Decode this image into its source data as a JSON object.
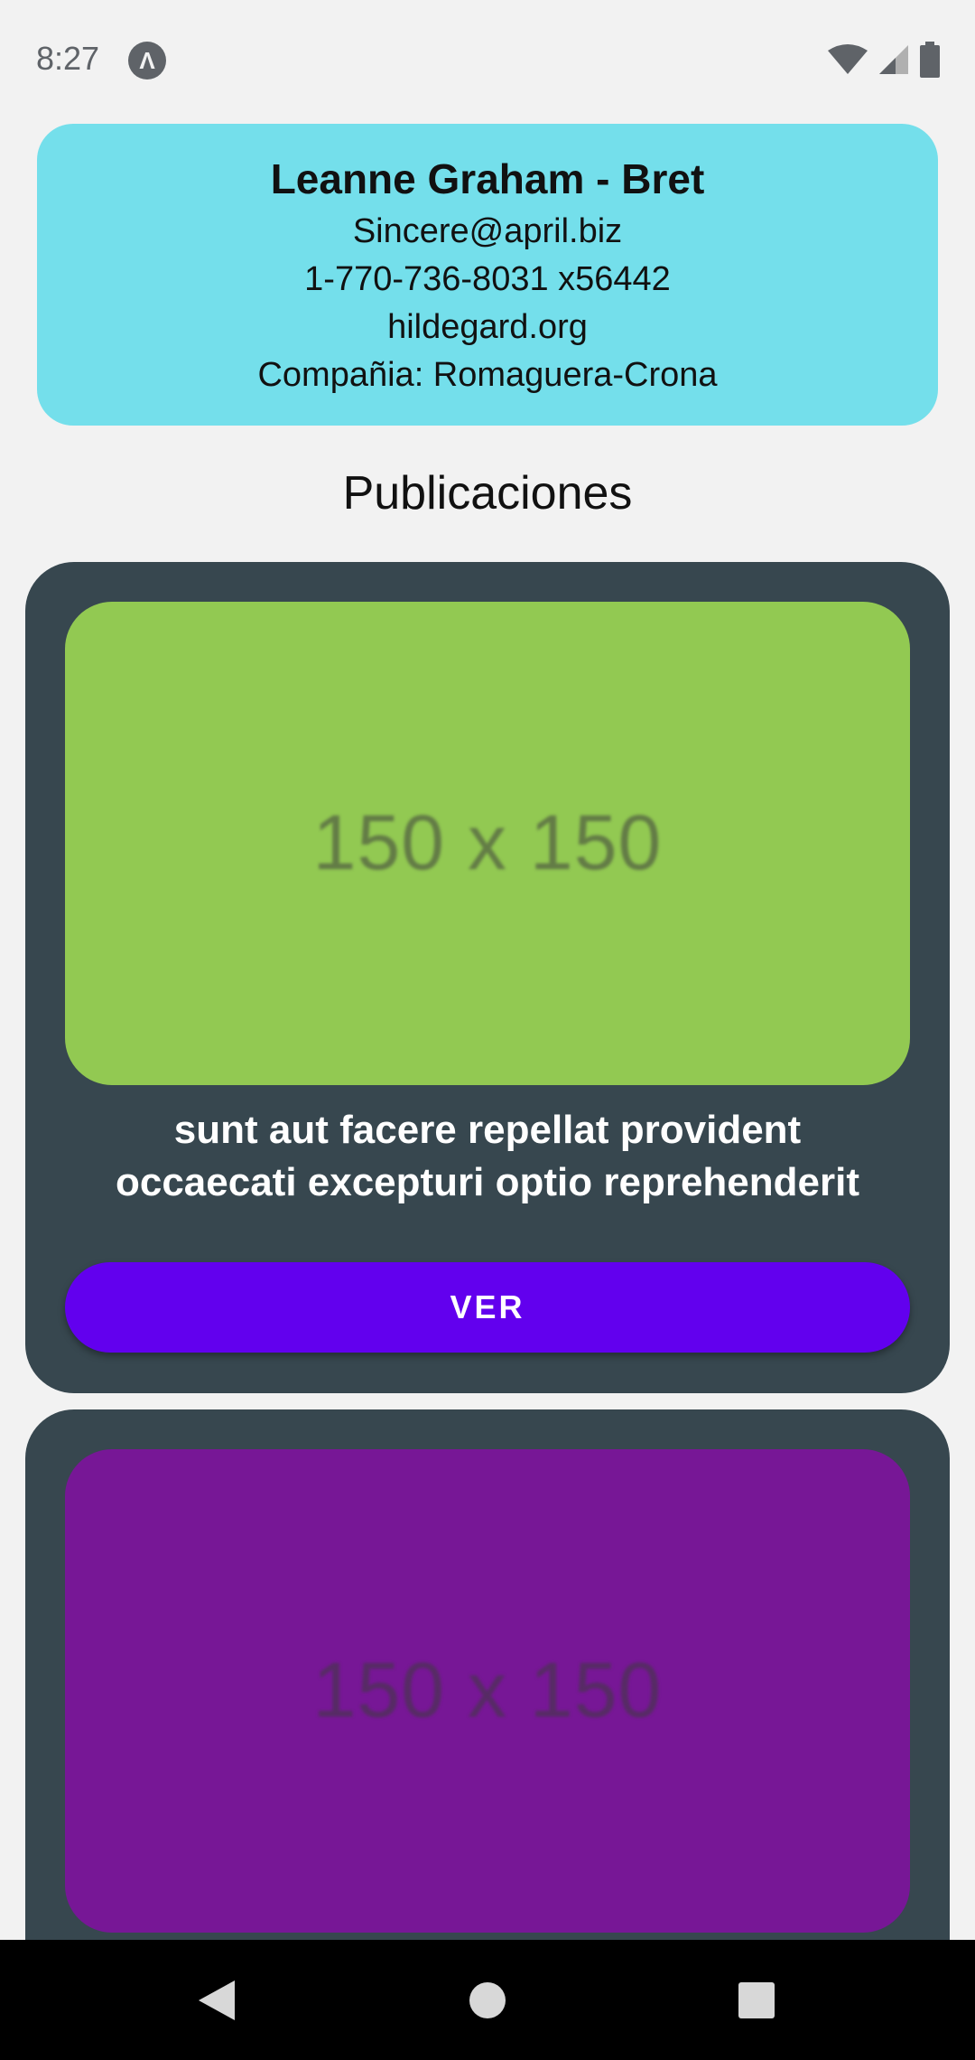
{
  "status_bar": {
    "time": "8:27",
    "app_icon_glyph": "Λ",
    "icons": [
      "wifi-icon",
      "signal-icon",
      "battery-icon"
    ]
  },
  "profile": {
    "name": "Leanne Graham",
    "separator": " - ",
    "username": "Bret",
    "email": "Sincere@april.biz",
    "phone": "1-770-736-8031 x56442",
    "website": "hildegard.org",
    "company_line": "Compañia: Romaguera-Crona",
    "background_color": "#74dfeb"
  },
  "section_title": "Publicaciones",
  "posts": [
    {
      "image_label": "150 x 150",
      "image_color": "#92c952",
      "title": "sunt aut facere repellat provident occaecati excepturi optio reprehenderit",
      "button_label": "VER"
    },
    {
      "image_label": "150 x 150",
      "image_color": "#771796"
    }
  ],
  "colors": {
    "card_background": "#37474f",
    "button_accent": "#6200ee",
    "screen_background": "#f2f2f2"
  },
  "nav_bar": {
    "buttons": [
      "back-icon",
      "home-icon",
      "recents-icon"
    ]
  }
}
